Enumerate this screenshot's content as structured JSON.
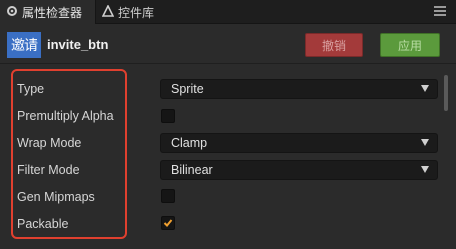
{
  "tabs": [
    {
      "label": "属性检查器",
      "icon": "gear-icon"
    },
    {
      "label": "控件库",
      "icon": "triangle-icon"
    }
  ],
  "header": {
    "avatar_text": "邀请",
    "node_name": "invite_btn",
    "revert_label": "撤销",
    "apply_label": "应用"
  },
  "properties": {
    "type": {
      "label": "Type",
      "value": "Sprite"
    },
    "premultiply_alpha": {
      "label": "Premultiply Alpha",
      "checked": false
    },
    "wrap_mode": {
      "label": "Wrap Mode",
      "value": "Clamp"
    },
    "filter_mode": {
      "label": "Filter Mode",
      "value": "Bilinear"
    },
    "gen_mipmaps": {
      "label": "Gen Mipmaps",
      "checked": false
    },
    "packable": {
      "label": "Packable",
      "checked": true
    }
  },
  "colors": {
    "background": "#2b2b2b",
    "revert": "#a33a3a",
    "apply": "#5b9a3c",
    "avatar": "#3a6fc4",
    "highlight": "#e0402f",
    "checkmark": "#f0a030"
  }
}
